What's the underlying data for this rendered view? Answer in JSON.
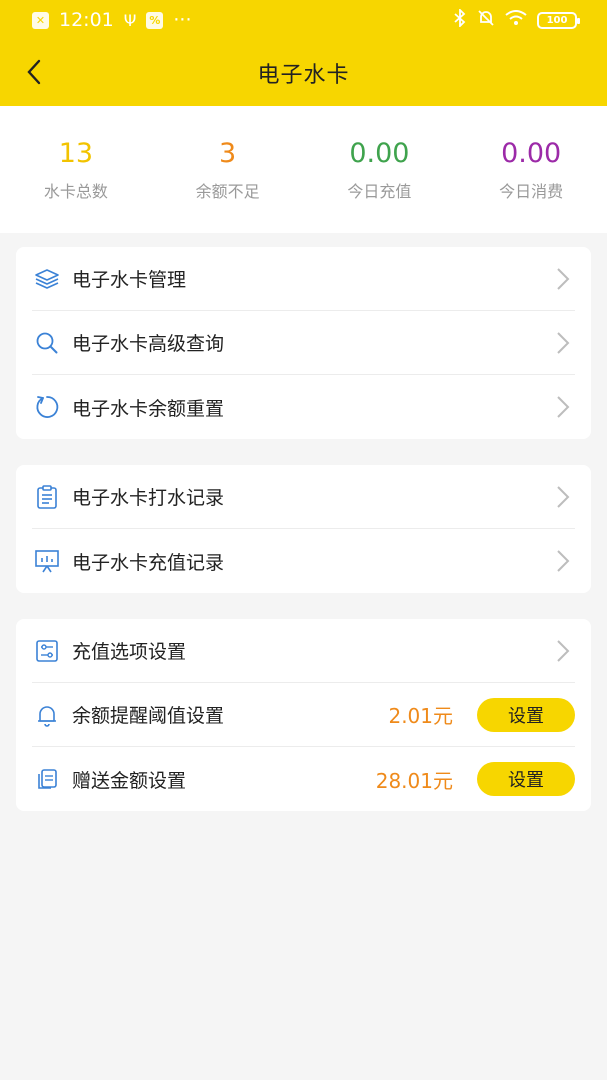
{
  "status_bar": {
    "time": "12:01",
    "dots": "···",
    "battery": "100"
  },
  "header": {
    "title": "电子水卡",
    "back_icon": "chevron-left-icon"
  },
  "stats": [
    {
      "value": "13",
      "label": "水卡总数",
      "color": "#f2c300"
    },
    {
      "value": "3",
      "label": "余额不足",
      "color": "#ef8a1a"
    },
    {
      "value": "0.00",
      "label": "今日充值",
      "color": "#3fa34d"
    },
    {
      "value": "0.00",
      "label": "今日消费",
      "color": "#9c2aa8"
    }
  ],
  "group1": [
    {
      "label": "电子水卡管理",
      "icon": "layers-icon"
    },
    {
      "label": "电子水卡高级查询",
      "icon": "search-icon"
    },
    {
      "label": "电子水卡余额重置",
      "icon": "refresh-icon"
    }
  ],
  "group2": [
    {
      "label": "电子水卡打水记录",
      "icon": "clipboard-icon"
    },
    {
      "label": "电子水卡充值记录",
      "icon": "presentation-chart-icon"
    }
  ],
  "group3": {
    "recharge_options": {
      "label": "充值选项设置",
      "icon": "sliders-icon"
    },
    "balance_alert": {
      "label": "余额提醒阈值设置",
      "icon": "bell-icon",
      "amount": "2.01元",
      "button": "设置"
    },
    "gift_amount": {
      "label": "赠送金额设置",
      "icon": "documents-icon",
      "amount": "28.01元",
      "button": "设置"
    }
  },
  "colors": {
    "accent": "#f7d600",
    "icon_blue": "#3b82d6",
    "amount_orange": "#ef8a1a"
  }
}
